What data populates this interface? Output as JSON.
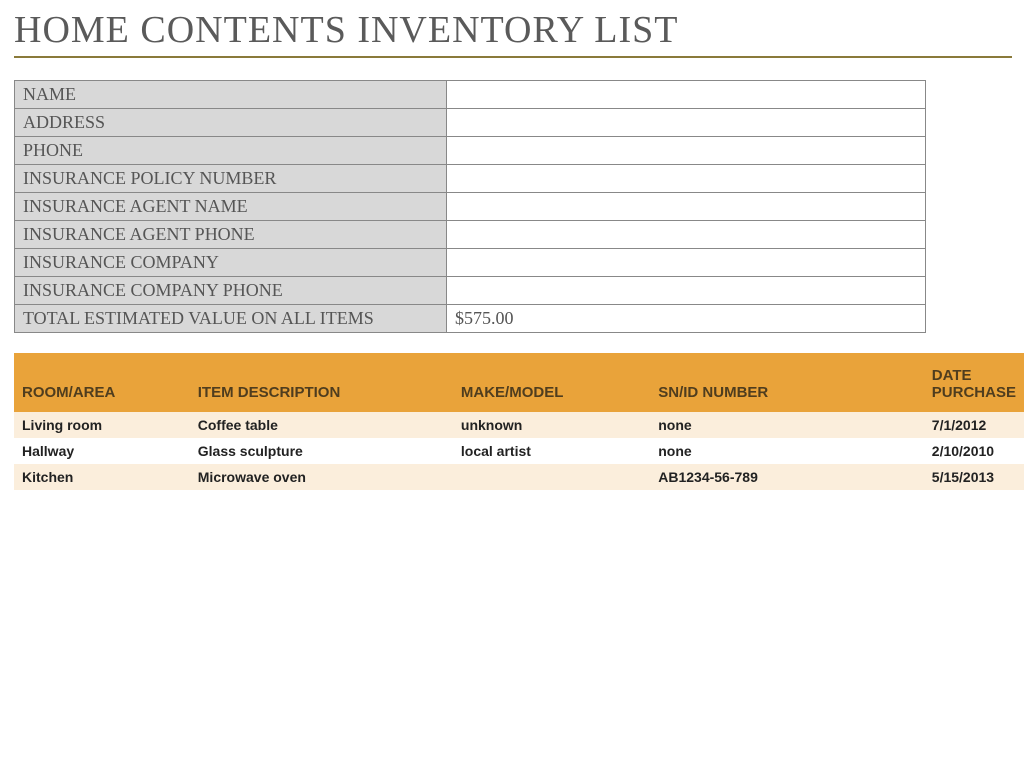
{
  "title": "HOME CONTENTS INVENTORY LIST",
  "info": {
    "rows": [
      {
        "label": "NAME",
        "value": ""
      },
      {
        "label": "ADDRESS",
        "value": ""
      },
      {
        "label": "PHONE",
        "value": ""
      },
      {
        "label": "INSURANCE POLICY NUMBER",
        "value": ""
      },
      {
        "label": "INSURANCE AGENT NAME",
        "value": ""
      },
      {
        "label": "INSURANCE AGENT PHONE",
        "value": ""
      },
      {
        "label": "INSURANCE COMPANY",
        "value": ""
      },
      {
        "label": "INSURANCE COMPANY PHONE",
        "value": ""
      },
      {
        "label": "TOTAL ESTIMATED VALUE ON ALL ITEMS",
        "value": "$575.00"
      }
    ]
  },
  "inventory": {
    "headers": {
      "room": "ROOM/AREA",
      "desc": "ITEM DESCRIPTION",
      "make": "MAKE/MODEL",
      "sn": "SN/ID NUMBER",
      "date": "DATE PURCHASE"
    },
    "rows": [
      {
        "room": "Living room",
        "desc": "Coffee table",
        "make": "unknown",
        "sn": "none",
        "date": "7/1/2012"
      },
      {
        "room": "Hallway",
        "desc": "Glass sculpture",
        "make": "local artist",
        "sn": "none",
        "date": "2/10/2010"
      },
      {
        "room": "Kitchen",
        "desc": "Microwave oven",
        "make": "",
        "sn": "AB1234-56-789",
        "date": "5/15/2013"
      }
    ]
  }
}
